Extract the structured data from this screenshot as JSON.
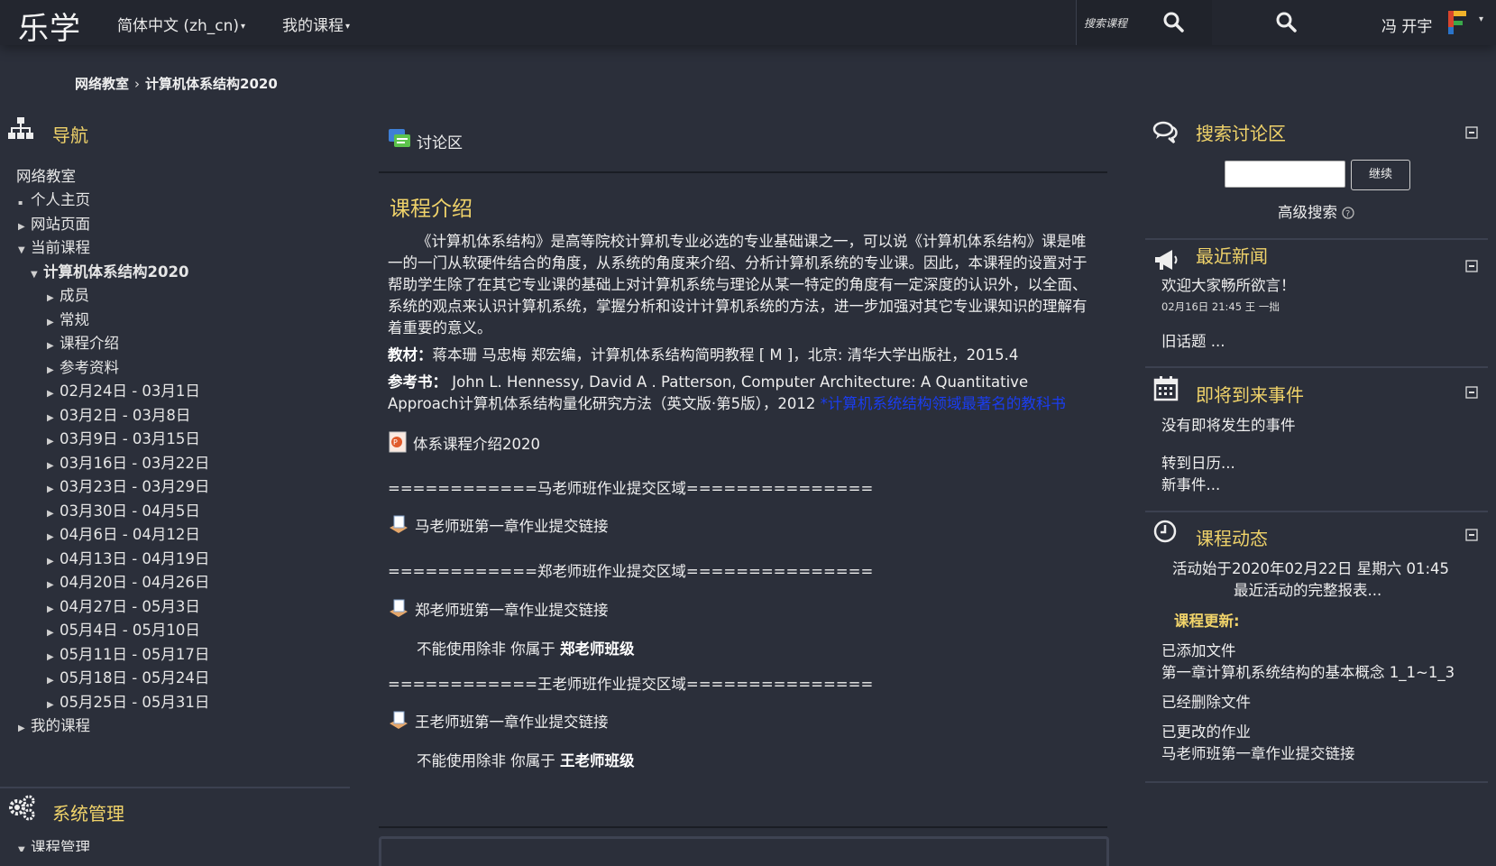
{
  "navbar": {
    "brand": "乐学",
    "language_menu": "简体中文 (zh_cn)",
    "my_courses_menu": "我的课程",
    "search_placeholder": "搜索课程",
    "user_name": "冯 开宇"
  },
  "breadcrumb": {
    "home": "网络教室",
    "separator": "›",
    "current": "计算机体系结构2020"
  },
  "left_nav": {
    "title": "导航",
    "root": "网络教室",
    "items": [
      {
        "label": "个人主页",
        "level": 1,
        "marker": "bullet"
      },
      {
        "label": "网站页面",
        "level": 1,
        "marker": "collapsed"
      },
      {
        "label": "当前课程",
        "level": 1,
        "marker": "expanded"
      },
      {
        "label": "计算机体系结构2020",
        "level": 2,
        "marker": "expanded",
        "bold": true
      },
      {
        "label": "成员",
        "level": 3,
        "marker": "collapsed"
      },
      {
        "label": "常规",
        "level": 3,
        "marker": "collapsed"
      },
      {
        "label": "课程介绍",
        "level": 3,
        "marker": "collapsed"
      },
      {
        "label": "参考资料",
        "level": 3,
        "marker": "collapsed"
      },
      {
        "label": "02月24日 - 03月1日",
        "level": 3,
        "marker": "collapsed"
      },
      {
        "label": "03月2日 - 03月8日",
        "level": 3,
        "marker": "collapsed"
      },
      {
        "label": "03月9日 - 03月15日",
        "level": 3,
        "marker": "collapsed"
      },
      {
        "label": "03月16日 - 03月22日",
        "level": 3,
        "marker": "collapsed"
      },
      {
        "label": "03月23日 - 03月29日",
        "level": 3,
        "marker": "collapsed"
      },
      {
        "label": "03月30日 - 04月5日",
        "level": 3,
        "marker": "collapsed"
      },
      {
        "label": "04月6日 - 04月12日",
        "level": 3,
        "marker": "collapsed"
      },
      {
        "label": "04月13日 - 04月19日",
        "level": 3,
        "marker": "collapsed"
      },
      {
        "label": "04月20日 - 04月26日",
        "level": 3,
        "marker": "collapsed"
      },
      {
        "label": "04月27日 - 05月3日",
        "level": 3,
        "marker": "collapsed"
      },
      {
        "label": "05月4日 - 05月10日",
        "level": 3,
        "marker": "collapsed"
      },
      {
        "label": "05月11日 - 05月17日",
        "level": 3,
        "marker": "collapsed"
      },
      {
        "label": "05月18日 - 05月24日",
        "level": 3,
        "marker": "collapsed"
      },
      {
        "label": "05月25日 - 05月31日",
        "level": 3,
        "marker": "collapsed"
      },
      {
        "label": "我的课程",
        "level": 1,
        "marker": "collapsed"
      }
    ],
    "admin_title": "系统管理",
    "admin_item": "课程管理"
  },
  "main": {
    "forum_label": "讨论区",
    "section_title": "课程介绍",
    "intro_paragraph": "《计算机体系结构》是高等院校计算机专业必选的专业基础课之一，可以说《计算机体系结构》课是唯一的一门从软硬件结合的角度，从系统的角度来介绍、分析计算机系统的专业课。因此，本课程的设置对于帮助学生除了在其它专业课的基础上对计算机系统与理论从某一特定的角度有一定深度的认识外，以全面、系统的观点来认识计算机系统，掌握分析和设计计算机系统的方法，进一步加强对其它专业课知识的理解有着重要的意义。",
    "textbook_label": "教材：",
    "textbook_text": "蒋本珊 马忠梅 郑宏编，计算机体系结构简明教程 [ M ]，北京: 清华大学出版社，2015.4",
    "reference_label": "参考书：",
    "reference_text": " John L. Hennessy, David A . Patterson, Computer Architecture: A Quantitative Approach计算机体系结构量化研究方法（英文版·第5版），2012 ",
    "reference_note": "*计算机系统结构领域最著名的教科书",
    "ppt_resource": "体系课程介绍2020",
    "divider_ma": "============马老师班作业提交区域===============",
    "assign_ma": "马老师班第一章作业提交链接",
    "divider_zheng": "============郑老师班作业提交区域===============",
    "assign_zheng": "郑老师班第一章作业提交链接",
    "restrict_prefix": "不能使用除非 你属于 ",
    "restrict_zheng_group": "郑老师班级",
    "divider_wang": "============王老师班作业提交区域===============",
    "assign_wang": "王老师班第一章作业提交链接",
    "restrict_wang_group": "王老师班级"
  },
  "right": {
    "search_forums_title": "搜索讨论区",
    "go_button": "继续",
    "advanced_search": "高级搜索",
    "news_title": "最近新闻",
    "news_item": "欢迎大家畅所欲言！",
    "news_meta": "02月16日 21:45  王 一拙",
    "old_topics": "旧话题 ...",
    "events_title": "即将到来事件",
    "no_events": "没有即将发生的事件",
    "goto_calendar": "转到日历...",
    "new_event": "新事件...",
    "activity_title": "课程动态",
    "activity_since": "活动始于2020年02月22日 星期六 01:45",
    "full_report": "最近活动的完整报表...",
    "updates_heading": "课程更新:",
    "added_file_label": "已添加文件",
    "added_file_name": "第一章计算机系统结构的基本概念 1_1~1_3",
    "deleted_file_label": "已经删除文件",
    "updated_assign_label": "已更改的作业",
    "updated_assign_name": "马老师班第一章作业提交链接"
  },
  "colors": {
    "background": "#2b2f3a",
    "navbar": "#23262f",
    "accent_heading": "#f0d36a",
    "link_blue": "#1a3df0"
  }
}
